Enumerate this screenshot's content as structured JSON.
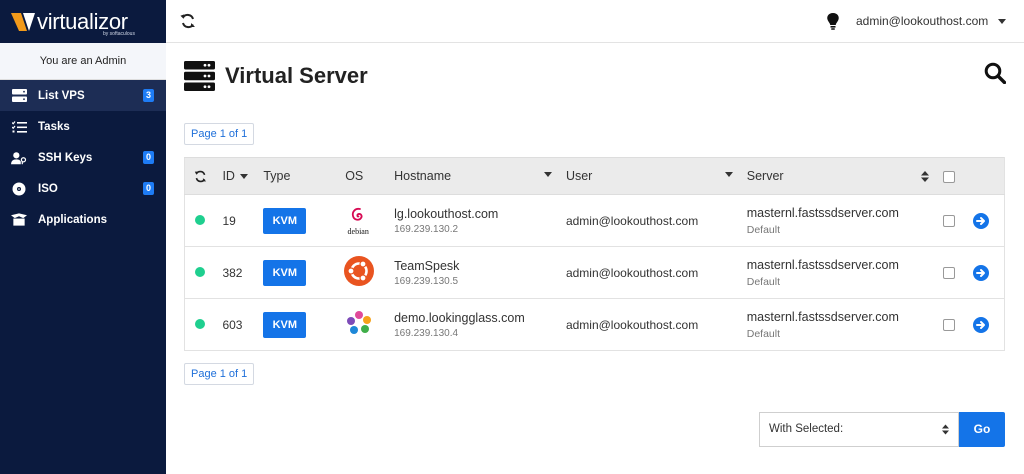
{
  "brand": {
    "name": "virtualizor",
    "tagline": "by softaculous"
  },
  "sidebar": {
    "role_text": "You are an Admin",
    "items": [
      {
        "label": "List VPS",
        "icon": "server-icon",
        "badge": "3",
        "active": true
      },
      {
        "label": "Tasks",
        "icon": "tasks-icon",
        "badge": "",
        "active": false
      },
      {
        "label": "SSH Keys",
        "icon": "key-user-icon",
        "badge": "0",
        "active": false
      },
      {
        "label": "ISO",
        "icon": "disc-icon",
        "badge": "0",
        "active": false
      },
      {
        "label": "Applications",
        "icon": "box-open-icon",
        "badge": "",
        "active": false
      }
    ]
  },
  "topbar": {
    "user": "admin@lookouthost.com"
  },
  "page": {
    "title": "Virtual Server"
  },
  "pager": {
    "label": "Page 1 of 1"
  },
  "table": {
    "headers": {
      "id": "ID",
      "type": "Type",
      "os": "OS",
      "hostname": "Hostname",
      "user": "User",
      "server": "Server"
    },
    "rows": [
      {
        "status": "online",
        "id": "19",
        "type": "KVM",
        "os": "debian",
        "os_label": "debian",
        "hostname": "lg.lookouthost.com",
        "ip": "169.239.130.2",
        "user": "admin@lookouthost.com",
        "server": "masternl.fastssdserver.com",
        "server_group": "Default"
      },
      {
        "status": "online",
        "id": "382",
        "type": "KVM",
        "os": "ubuntu",
        "os_label": "",
        "hostname": "TeamSpesk",
        "ip": "169.239.130.5",
        "user": "admin@lookouthost.com",
        "server": "masternl.fastssdserver.com",
        "server_group": "Default"
      },
      {
        "status": "online",
        "id": "603",
        "type": "KVM",
        "os": "fedora-like",
        "os_label": "",
        "hostname": "demo.lookingglass.com",
        "ip": "169.239.130.4",
        "user": "admin@lookouthost.com",
        "server": "masternl.fastssdserver.com",
        "server_group": "Default"
      }
    ]
  },
  "bulk": {
    "select_value": "With Selected:",
    "go_label": "Go"
  },
  "colors": {
    "sidebar_bg": "#0b1a3e",
    "accent": "#1474e8",
    "status_online": "#1fcf8f",
    "logo_orange": "#f29a1a"
  }
}
